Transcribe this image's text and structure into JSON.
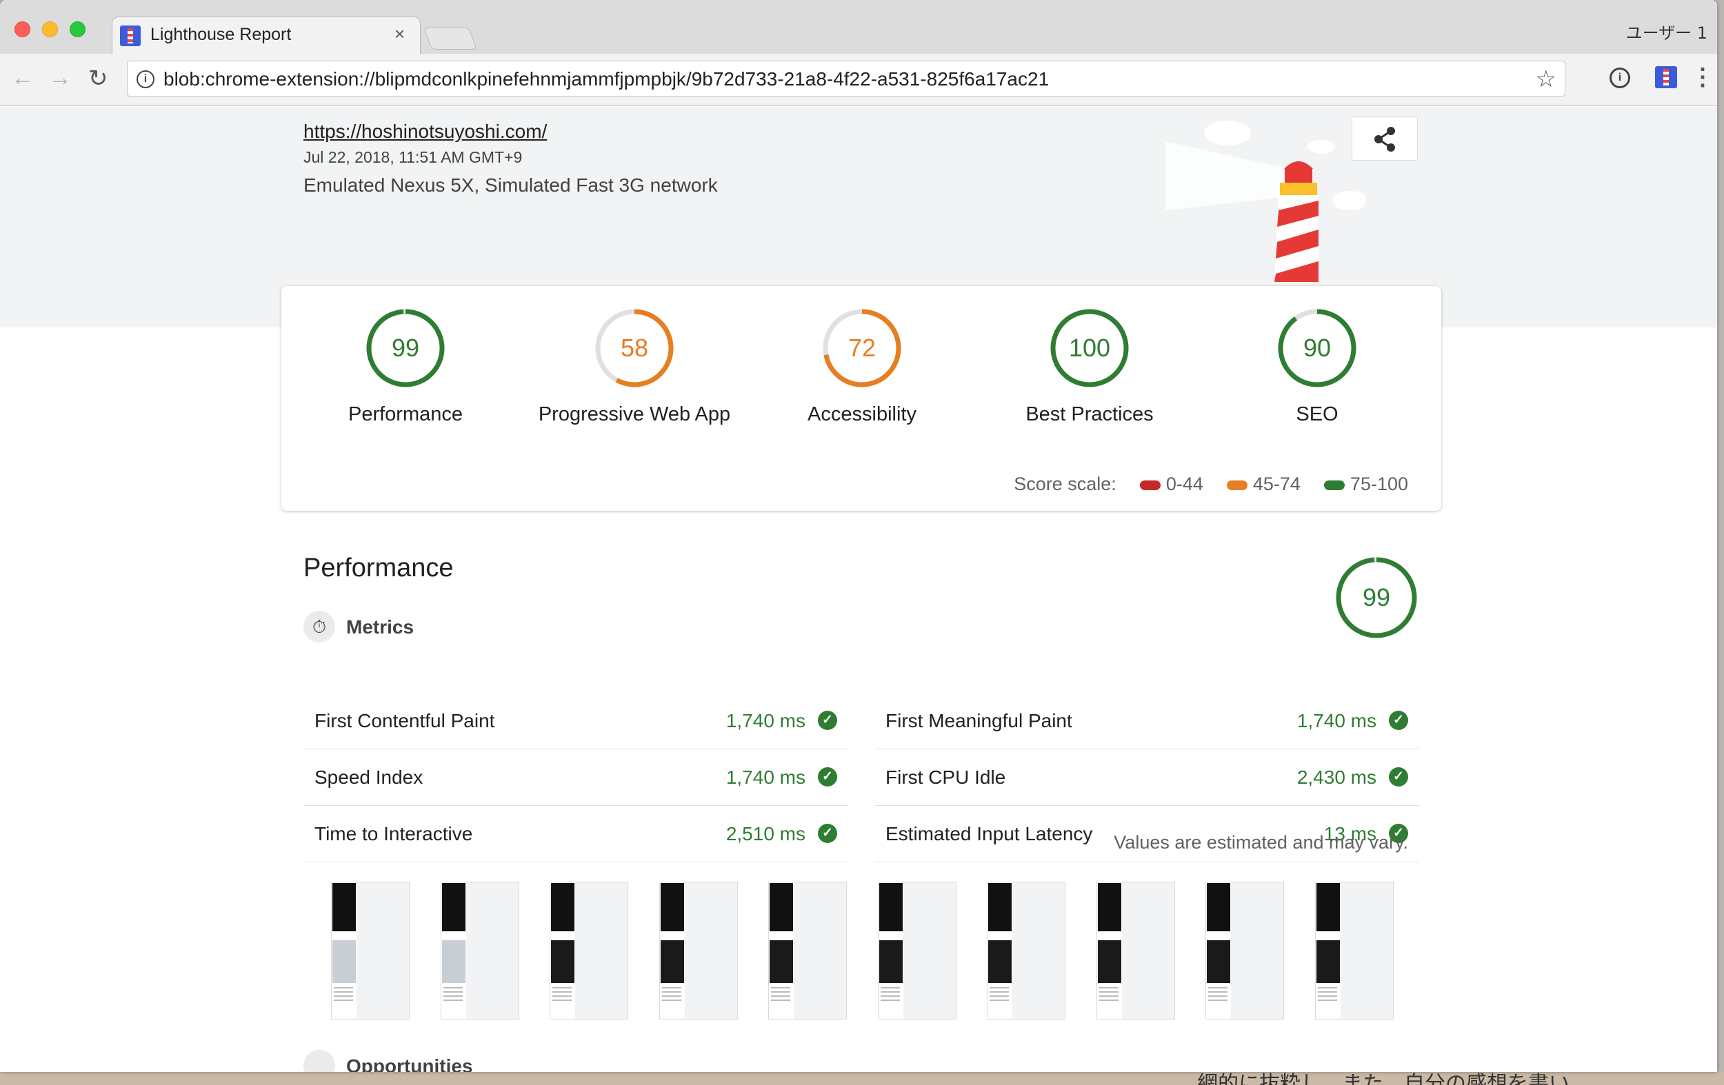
{
  "browser": {
    "tab_title": "Lighthouse Report",
    "tab_close": "×",
    "profile": "ユーザー 1",
    "url": "blob:chrome-extension://blipmdconlkpinefehnmjammfjpmpbjk/9b72d733-21a8-4f22-a531-825f6a17ac21",
    "back": "←",
    "forward": "→",
    "reload": "↻",
    "star": "☆",
    "menu": "⋮",
    "info": "i",
    "ext_info": "i"
  },
  "report": {
    "site_url": "https://hoshinotsuyoshi.com/",
    "date": "Jul 22, 2018, 11:51 AM GMT+9",
    "environment": "Emulated Nexus 5X, Simulated Fast 3G network"
  },
  "scores": [
    {
      "label": "Performance",
      "value": "99",
      "score": 99,
      "color": "#2e7d32"
    },
    {
      "label": "Progressive Web App",
      "value": "58",
      "score": 58,
      "color": "#e67e22"
    },
    {
      "label": "Accessibility",
      "value": "72",
      "score": 72,
      "color": "#e67e22"
    },
    {
      "label": "Best Practices",
      "value": "100",
      "score": 100,
      "color": "#2e7d32"
    },
    {
      "label": "SEO",
      "value": "90",
      "score": 90,
      "color": "#2e7d32"
    }
  ],
  "scale": {
    "label": "Score scale:",
    "items": [
      {
        "range": "0-44",
        "color": "#c62828"
      },
      {
        "range": "45-74",
        "color": "#e67e22"
      },
      {
        "range": "75-100",
        "color": "#2e7d32"
      }
    ]
  },
  "performance": {
    "title": "Performance",
    "score": "99",
    "metrics_label": "Metrics",
    "metrics": [
      {
        "name": "First Contentful Paint",
        "value": "1,740 ms"
      },
      {
        "name": "First Meaningful Paint",
        "value": "1,740 ms"
      },
      {
        "name": "Speed Index",
        "value": "1,740 ms"
      },
      {
        "name": "First CPU Idle",
        "value": "2,430 ms"
      },
      {
        "name": "Time to Interactive",
        "value": "2,510 ms"
      },
      {
        "name": "Estimated Input Latency",
        "value": "13 ms"
      }
    ],
    "estimate_note": "Values are estimated and may vary.",
    "filmstrip_frames": 10,
    "opportunities_label": "Opportunities"
  },
  "desktop": {
    "background_text": "網的に抜粋し、また、自分の感想を書い"
  },
  "colors": {
    "pass": "#2e7d32",
    "average": "#e67e22",
    "fail": "#c62828",
    "hero_bg": "#f1f3f4"
  }
}
